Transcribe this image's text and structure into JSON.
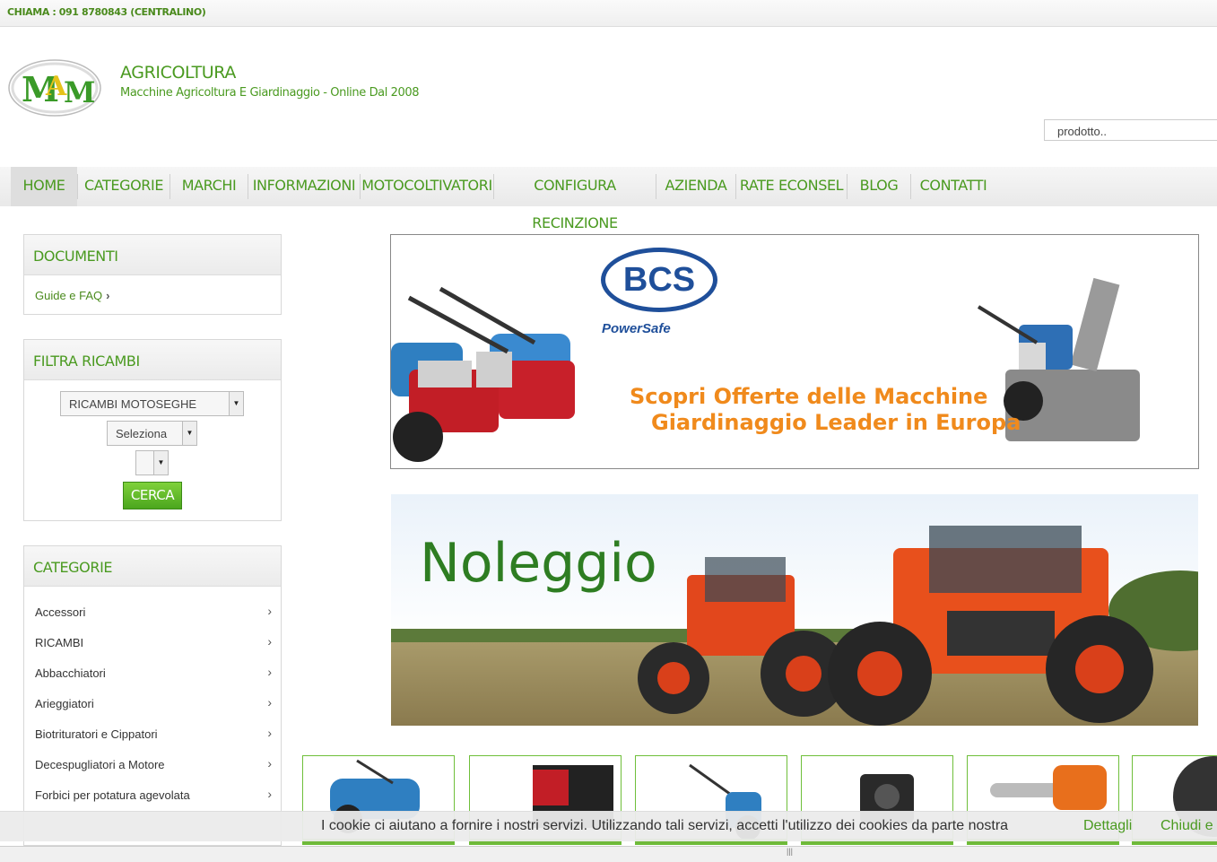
{
  "topbar": {
    "phone": "CHIAMA : 091 8780843 (CENTRALINO)"
  },
  "header": {
    "title": "AGRICOLTURA",
    "subtitle": "Macchine Agricoltura E Giardinaggio - Online Dal 2008",
    "logo_text": "MAM",
    "search_placeholder": "prodotto.."
  },
  "nav": [
    {
      "label": "HOME"
    },
    {
      "label": "CATEGORIE"
    },
    {
      "label": "MARCHI"
    },
    {
      "label": "INFORMAZIONI"
    },
    {
      "label": "MOTOCOLTIVATORI"
    },
    {
      "label": "CONFIGURA RECINZIONE"
    },
    {
      "label": "AZIENDA"
    },
    {
      "label": "RATE ECONSEL"
    },
    {
      "label": "BLOG"
    },
    {
      "label": "CONTATTI"
    }
  ],
  "documents": {
    "title": "DOCUMENTI",
    "link": "Guide e FAQ"
  },
  "filter": {
    "title": "FILTRA RICAMBI",
    "select1": "RICAMBI MOTOSEGHE",
    "select2": "Seleziona",
    "select3": "",
    "button": "CERCA"
  },
  "categories": {
    "title": "CATEGORIE",
    "items": [
      "Accessori",
      "RICAMBI",
      "Abbacchiatori",
      "Arieggiatori",
      "Biotrituratori e Cippatori",
      "Decespugliatori a Motore",
      "Forbici per potatura agevolata"
    ]
  },
  "banner1": {
    "brand": "BCS",
    "brand_sub": "PowerSafe",
    "line1": "Scopri Offerte delle Macchine",
    "line2": "Giardinaggio Leader in Europa"
  },
  "banner2": {
    "title": "Noleggio"
  },
  "cookie": {
    "text": "I cookie ci aiutano a fornire i nostri servizi. Utilizzando tali servizi, accetti l'utilizzo dei cookies da parte nostra",
    "details": "Dettagli",
    "close": "Chiudi e"
  },
  "colors": {
    "accent_green": "#4a9a20",
    "banner_orange": "#f08a1c",
    "noleggio_green": "#2e7d22"
  }
}
